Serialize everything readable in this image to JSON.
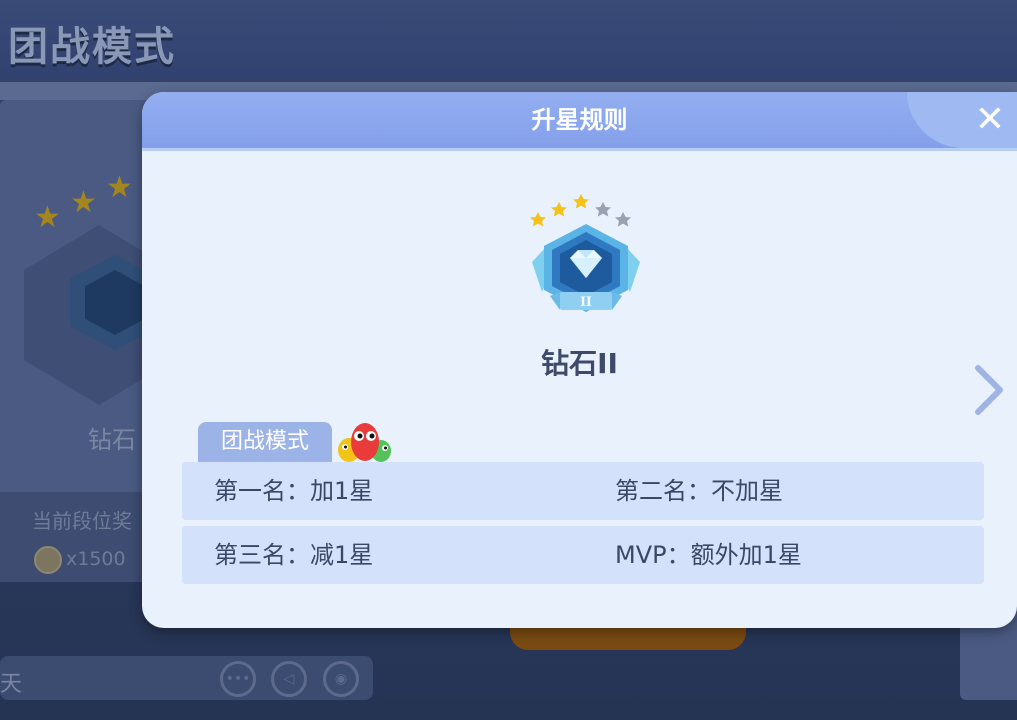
{
  "background": {
    "title": "团战模式",
    "rank_label": "钻石",
    "reward_label": "当前段位奖",
    "coin_count": "x1500",
    "chat_label": "天"
  },
  "modal": {
    "title": "升星规则",
    "close_icon": "close-icon",
    "badge": {
      "tier_numeral": "II",
      "stars_filled": 3,
      "stars_total": 5
    },
    "rank_name": "钻石II",
    "mode_tab": "团战模式",
    "rules": [
      {
        "left": "第一名：加1星",
        "right": "第二名：不加星"
      },
      {
        "left": "第三名：减1星",
        "right": "MVP：额外加1星"
      }
    ]
  },
  "colors": {
    "header": "#84a0ea",
    "panel": "#e9f1fd",
    "row": "#d3e1fb",
    "tab": "#9cb3e8",
    "star_gold": "#f5c21a",
    "star_gray": "#9aa2b2"
  }
}
